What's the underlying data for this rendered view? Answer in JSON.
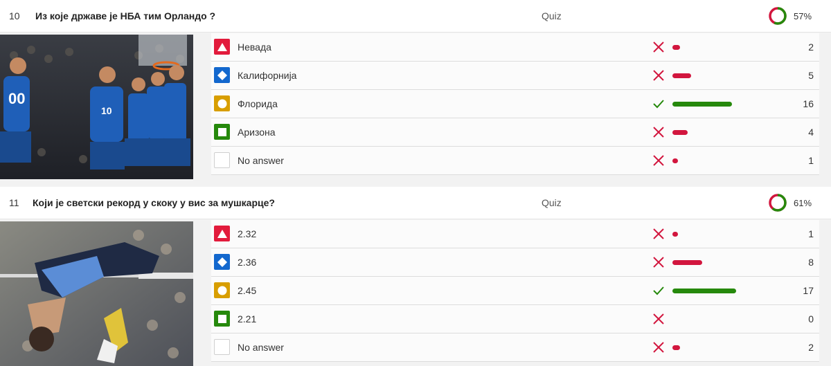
{
  "questions": [
    {
      "number": "10",
      "text": "Из које државе је НБА тим Орландо ?",
      "type": "Quiz",
      "percent": "57%",
      "percent_value": 57,
      "answers": [
        {
          "shape": "triangle",
          "label": "Невада",
          "correct": false,
          "count": "2"
        },
        {
          "shape": "diamond",
          "label": "Калифорнија",
          "correct": false,
          "count": "5"
        },
        {
          "shape": "circle",
          "label": "Флорида",
          "correct": true,
          "count": "16"
        },
        {
          "shape": "square",
          "label": "Аризона",
          "correct": false,
          "count": "4"
        },
        {
          "shape": "none",
          "label": "No answer",
          "correct": false,
          "count": "1"
        }
      ]
    },
    {
      "number": "11",
      "text": "Који је светски рекорд у скоку у вис за мушкарце?",
      "type": "Quiz",
      "percent": "61%",
      "percent_value": 61,
      "answers": [
        {
          "shape": "triangle",
          "label": "2.32",
          "correct": false,
          "count": "1"
        },
        {
          "shape": "diamond",
          "label": "2.36",
          "correct": false,
          "count": "8"
        },
        {
          "shape": "circle",
          "label": "2.45",
          "correct": true,
          "count": "17"
        },
        {
          "shape": "square",
          "label": "2.21",
          "correct": false,
          "count": "0"
        },
        {
          "shape": "none",
          "label": "No answer",
          "correct": false,
          "count": "2"
        }
      ]
    }
  ],
  "colors": {
    "correct": "#26890c",
    "wrong": "#d2163e",
    "red": "#e21b3c",
    "blue": "#1368ce",
    "yellow": "#d89e00",
    "green": "#26890c"
  },
  "icons": {
    "correct": "check-icon",
    "wrong": "cross-icon",
    "triangle": "triangle-icon",
    "diamond": "diamond-icon",
    "circle": "circle-icon",
    "square": "square-icon"
  }
}
